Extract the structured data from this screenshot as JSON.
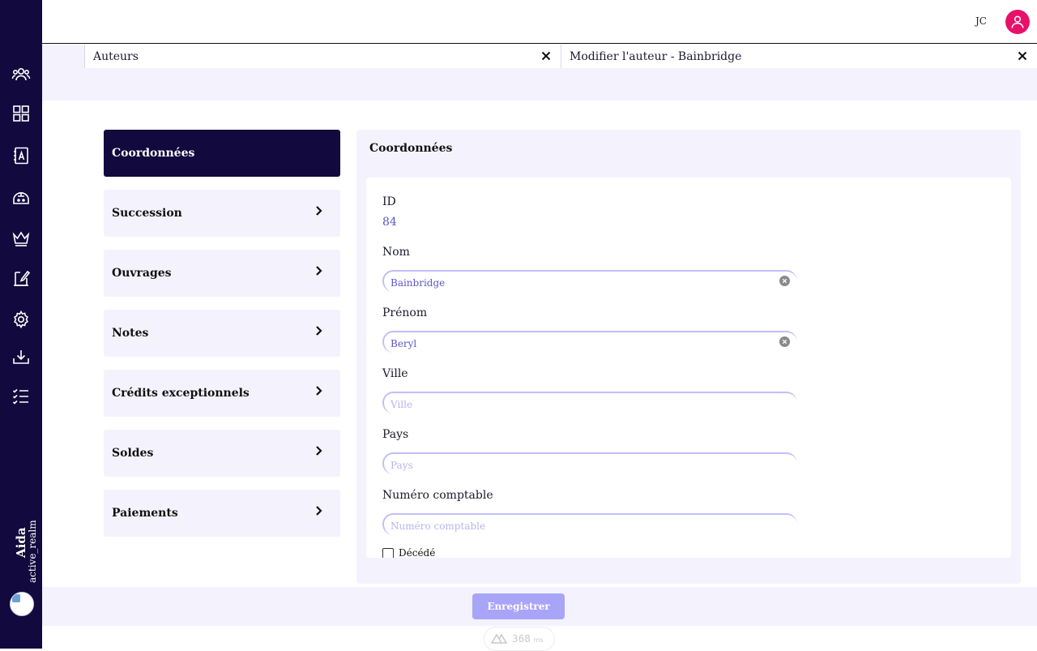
{
  "sidebar": {
    "icons": [
      "users-icon",
      "dashboard-grid-icon",
      "contacts-book-icon",
      "cash-register-icon",
      "crown-icon",
      "contract-sign-icon",
      "gear-icon",
      "download-icon",
      "checklist-icon"
    ],
    "brand_name": "Aida",
    "brand_realm": "active_realm"
  },
  "topbar": {
    "user_initials": "JC"
  },
  "tabs": [
    {
      "label": "Auteurs"
    },
    {
      "label": "Modifier l'auteur - Bainbridge"
    }
  ],
  "menu": {
    "items": [
      {
        "label": "Coordonnées",
        "active": true
      },
      {
        "label": "Succession"
      },
      {
        "label": "Ouvrages"
      },
      {
        "label": "Notes"
      },
      {
        "label": "Crédits exceptionnels"
      },
      {
        "label": "Soldes"
      },
      {
        "label": "Paiements"
      }
    ]
  },
  "panel": {
    "title": "Coordonnées",
    "id_label": "ID",
    "id_value": "84",
    "fields": [
      {
        "label": "Nom",
        "value": "Bainbridge",
        "placeholder": ""
      },
      {
        "label": "Prénom",
        "value": "Beryl",
        "placeholder": ""
      },
      {
        "label": "Ville",
        "value": "",
        "placeholder": "Ville"
      },
      {
        "label": "Pays",
        "value": "",
        "placeholder": "Pays"
      },
      {
        "label": "Numéro comptable",
        "value": "",
        "placeholder": "Numéro comptable"
      }
    ],
    "deceased_label": "Décédé",
    "deceased_checked": false
  },
  "footer": {
    "save_label": "Enregistrer"
  },
  "devtools": {
    "load_time": "368",
    "unit": "ms"
  },
  "colors": {
    "sidebar": "#120a3e",
    "accent": "#a8a4f7",
    "avatar": "#e8106a",
    "panel_bg": "#f4f3fd"
  }
}
